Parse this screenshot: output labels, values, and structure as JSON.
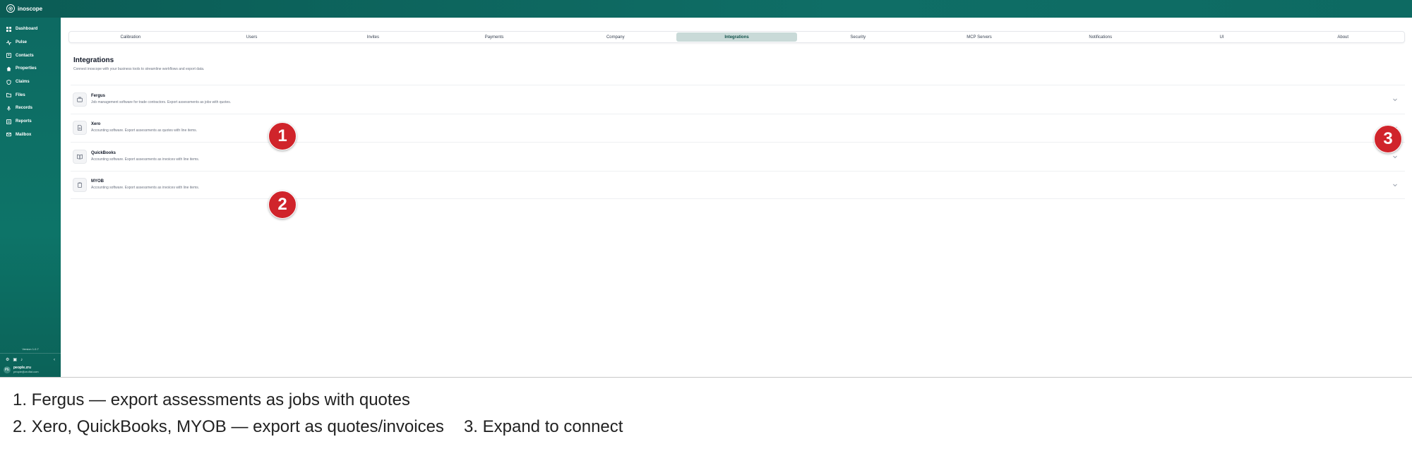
{
  "app": {
    "brand": "inoscope"
  },
  "sidebar": {
    "items": [
      {
        "label": "Dashboard",
        "icon": "grid-icon"
      },
      {
        "label": "Pulse",
        "icon": "pulse-icon"
      },
      {
        "label": "Contacts",
        "icon": "contacts-icon"
      },
      {
        "label": "Properties",
        "icon": "home-icon"
      },
      {
        "label": "Claims",
        "icon": "shield-icon"
      },
      {
        "label": "Files",
        "icon": "folder-icon"
      },
      {
        "label": "Records",
        "icon": "mic-icon"
      },
      {
        "label": "Reports",
        "icon": "report-icon"
      },
      {
        "label": "Mailbox",
        "icon": "mail-icon"
      }
    ],
    "version": "Version 1.0.7",
    "footer_icons": [
      "settings-icon",
      "book-icon",
      "bell-icon"
    ],
    "collapse": "‹",
    "user": {
      "initials": "PE",
      "name": "people.zru",
      "email": "people@zruflat.com"
    }
  },
  "tabs": [
    {
      "label": "Calibration",
      "active": false
    },
    {
      "label": "Users",
      "active": false
    },
    {
      "label": "Invites",
      "active": false
    },
    {
      "label": "Payments",
      "active": false
    },
    {
      "label": "Company",
      "active": false
    },
    {
      "label": "Integrations",
      "active": true
    },
    {
      "label": "Security",
      "active": false
    },
    {
      "label": "MCP Servers",
      "active": false
    },
    {
      "label": "Notifications",
      "active": false
    },
    {
      "label": "UI",
      "active": false
    },
    {
      "label": "About",
      "active": false
    }
  ],
  "section": {
    "title": "Integrations",
    "subtitle": "Connect inoscope with your business tools to streamline workflows and export data."
  },
  "integrations": [
    {
      "name": "Fergus",
      "description": "Job management software for trade contractors. Export assessments as jobs with quotes.",
      "icon": "briefcase-icon"
    },
    {
      "name": "Xero",
      "description": "Accounting software. Export assessments as quotes with line items.",
      "icon": "document-icon"
    },
    {
      "name": "QuickBooks",
      "description": "Accounting software. Export assessments as invoices with line items.",
      "icon": "book-open-icon"
    },
    {
      "name": "MYOB",
      "description": "Accounting software. Export assessments as invoices with line items.",
      "icon": "clipboard-icon"
    }
  ],
  "markers": [
    "1",
    "2",
    "3"
  ],
  "caption": {
    "line1": "1. Fergus — export assessments as jobs with quotes",
    "line2a": "2. Xero, QuickBooks, MYOB — export as quotes/invoices",
    "line2b": "3. Expand to connect"
  },
  "colors": {
    "sidebar": "#0d6a62",
    "active_tab": "#c9dad8",
    "marker": "#d0242b"
  }
}
